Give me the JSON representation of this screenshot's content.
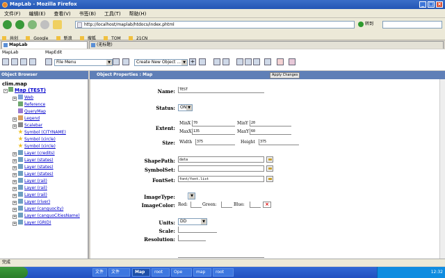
{
  "window": {
    "title": "MapLab - Mozilla Firefox"
  },
  "menu": [
    "文件(F)",
    "编辑(E)",
    "查看(V)",
    "书签(B)",
    "工具(T)",
    "帮助(H)"
  ],
  "nav": {
    "url": "http://localhost/maplab/htdocs/index.phtml",
    "go_label": "转到"
  },
  "bookmarks": [
    "共创",
    "Google",
    "新浪",
    "搜狐",
    "TOM",
    "21CN"
  ],
  "tabs": [
    "MapLab",
    "(无标题)"
  ],
  "apptoolbar": {
    "label_maplab": "MapLab",
    "label_mapedit": "MapEdit",
    "file_menu": "File Menu",
    "create_object": "Create New Object ..."
  },
  "left_panel": {
    "header": "Object Browser",
    "root": "clim.map",
    "map_node": "Map (TEST)",
    "items": [
      {
        "label": "Web",
        "icon": "web-icon",
        "expander": true
      },
      {
        "label": "Reference",
        "icon": "reference-icon",
        "expander": false
      },
      {
        "label": "QueryMap",
        "icon": "querymap-icon",
        "expander": false
      },
      {
        "label": "Legend",
        "icon": "legend-icon",
        "expander": true
      },
      {
        "label": "Scalebar",
        "icon": "scalebar-icon",
        "expander": true
      },
      {
        "label": "Symbol (CITYNAME)",
        "icon": "star-icon",
        "expander": false
      },
      {
        "label": "Symbol (circle)",
        "icon": "star-icon",
        "expander": false
      },
      {
        "label": "Symbol (circle)",
        "icon": "star-icon",
        "expander": false
      },
      {
        "label": "Layer (credits)",
        "icon": "layer-icon",
        "expander": true
      },
      {
        "label": "Layer (states)",
        "icon": "layer-icon",
        "expander": true
      },
      {
        "label": "Layer (states)",
        "icon": "layer-icon",
        "expander": true
      },
      {
        "label": "Layer (states)",
        "icon": "layer-icon",
        "expander": true
      },
      {
        "label": "Layer (rail)",
        "icon": "layer-icon",
        "expander": true
      },
      {
        "label": "Layer (rail)",
        "icon": "layer-icon",
        "expander": true
      },
      {
        "label": "Layer (rail)",
        "icon": "layer-icon",
        "expander": true
      },
      {
        "label": "Layer (river)",
        "icon": "layer-icon",
        "expander": true
      },
      {
        "label": "Layer (canguocity)",
        "icon": "layer-icon",
        "expander": true
      },
      {
        "label": "Layer (canguoCitiesName)",
        "icon": "layer-icon",
        "expander": true
      },
      {
        "label": "Layer (GRID)",
        "icon": "layer-icon",
        "expander": true
      }
    ]
  },
  "right_panel": {
    "header": "Object Properties : Map",
    "apply_label": "Apply Changes",
    "fields": {
      "name_label": "Name:",
      "name_value": "TEST",
      "status_label": "Status:",
      "status_value": "ON",
      "extent_label": "Extent:",
      "minx_label": "MinX",
      "minx_value": "70",
      "miny_label": "MinY",
      "miny_value": "20",
      "maxx_label": "MaxX",
      "maxx_value": "135",
      "maxy_label": "MaxY",
      "maxy_value": "60",
      "size_label": "Size:",
      "width_label": "Width",
      "width_value": "375",
      "height_label": "Height",
      "height_value": "375",
      "shapepath_label": "ShapePath:",
      "shapepath_value": "data",
      "symbolset_label": "SymbolSet:",
      "symbolset_value": "",
      "fontset_label": "FontSet:",
      "fontset_value": "font/font.list",
      "imagetype_label": "ImageType:",
      "imagetype_value": "",
      "imagecolor_label": "ImageColor:",
      "red_label": "Red:",
      "green_label": "Green:",
      "blue_label": "Blue:",
      "units_label": "Units:",
      "units_value": "DD",
      "scale_label": "Scale:",
      "resolution_label": "Resolution:"
    }
  },
  "statusbar": {
    "text": "完成"
  },
  "taskbar": {
    "items": [
      "文件",
      "文件",
      "Map",
      "root",
      "Ope",
      "map",
      "root"
    ],
    "clock": "12:32"
  }
}
